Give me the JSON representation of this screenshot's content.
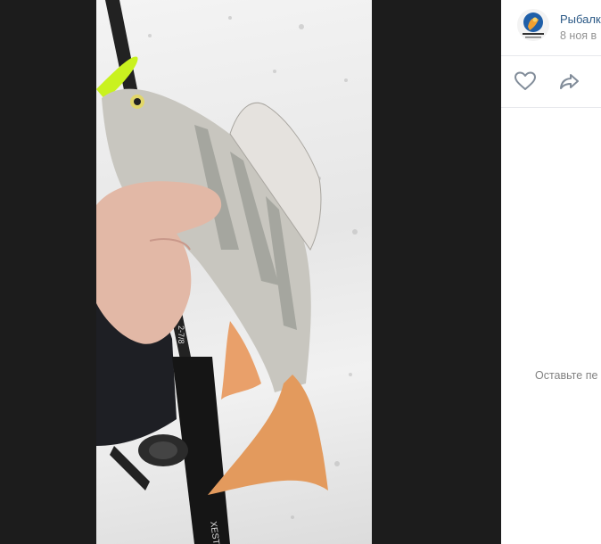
{
  "post": {
    "author": "Рыбалк",
    "date": "8 ноя в"
  },
  "photo": {
    "rod_mark": "XESTA",
    "rod_spec": "2-7/8"
  },
  "actions": {
    "like_icon": "heart-icon",
    "share_icon": "share-arrow-icon"
  },
  "comments": {
    "empty_text": "Оставьте пе"
  },
  "colors": {
    "viewer_bg": "#1c1c1c",
    "link": "#2a5885",
    "muted": "#939393",
    "icon": "#818c99"
  }
}
